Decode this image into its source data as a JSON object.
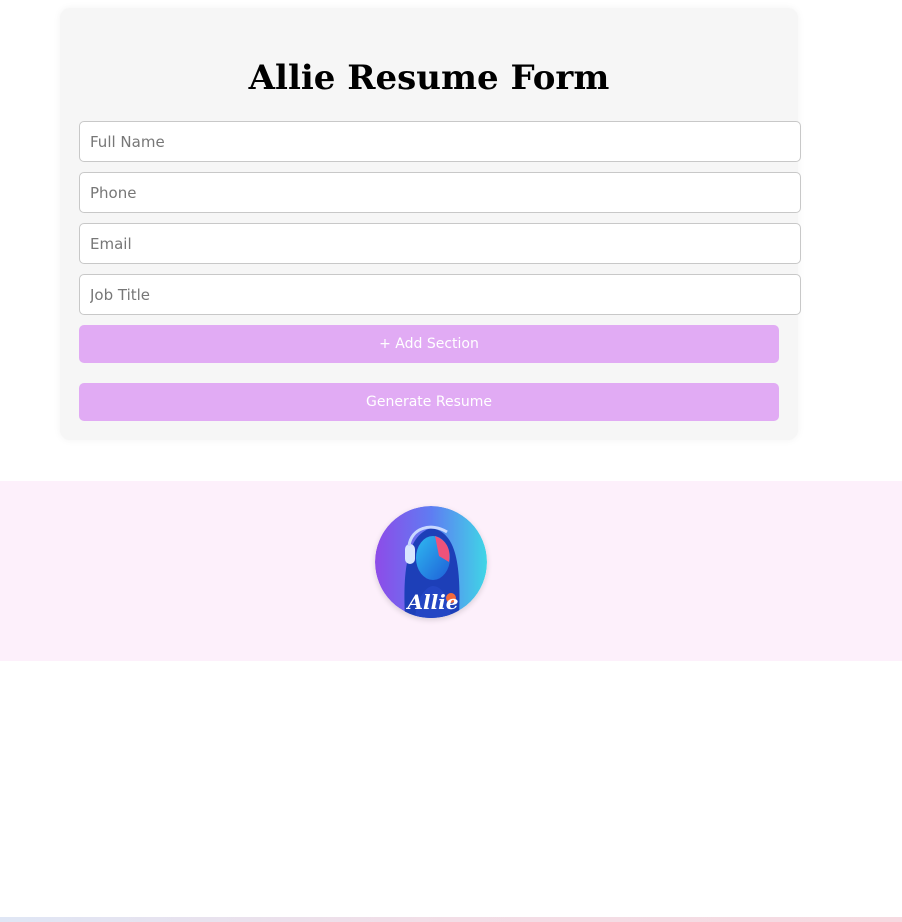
{
  "form": {
    "title": "Allie Resume Form",
    "fields": [
      {
        "placeholder": "Full Name",
        "value": ""
      },
      {
        "placeholder": "Phone",
        "value": ""
      },
      {
        "placeholder": "Email",
        "value": ""
      },
      {
        "placeholder": "Job Title",
        "value": ""
      }
    ],
    "add_section_label": "+ Add Section",
    "generate_label": "Generate Resume",
    "button_color": "#e1abf4"
  },
  "footer": {
    "avatar_icon": "allie-avatar-logo",
    "avatar_text": "Allie"
  }
}
